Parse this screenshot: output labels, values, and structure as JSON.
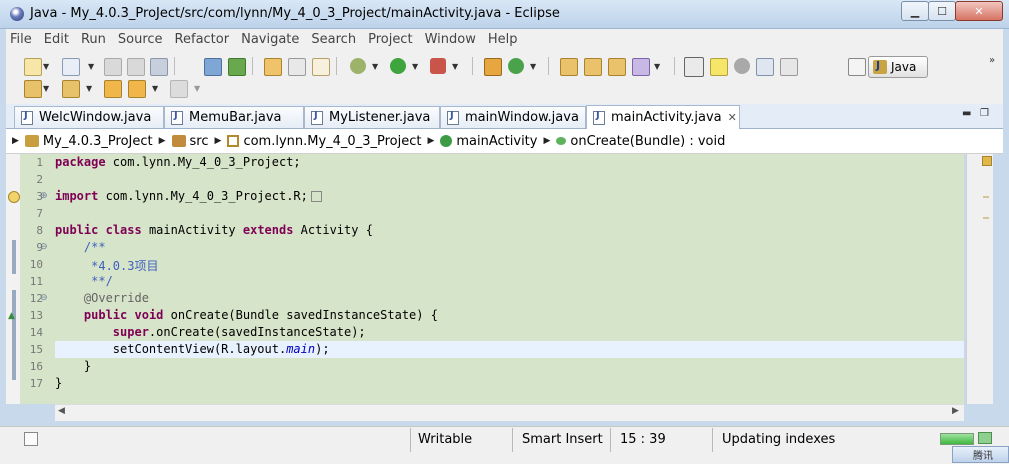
{
  "window": {
    "title": "Java - My_4.0.3_ProJect/src/com/lynn/My_4_0_3_Project/mainActivity.java - Eclipse",
    "minimize_glyph": "▁",
    "maximize_glyph": "☐",
    "close_glyph": "✕"
  },
  "menu": [
    "File",
    "Edit",
    "Run",
    "Source",
    "Refactor",
    "Navigate",
    "Search",
    "Project",
    "Window",
    "Help"
  ],
  "perspective": {
    "label": "Java"
  },
  "tabs": [
    {
      "label": "WelcWindow.java"
    },
    {
      "label": "MemuBar.java"
    },
    {
      "label": "MyListener.java"
    },
    {
      "label": "mainWindow.java"
    },
    {
      "label": "mainActivity.java",
      "active": true
    }
  ],
  "breadcrumb": [
    "My_4.0.3_ProJect",
    "src",
    "com.lynn.My_4_0_3_Project",
    "mainActivity",
    "onCreate(Bundle) : void"
  ],
  "code": {
    "line_numbers": [
      "1",
      "2",
      "3",
      "7",
      "8",
      "9",
      "10",
      "11",
      "12",
      "13",
      "14",
      "15",
      "16",
      "17"
    ],
    "lines": {
      "l1_kw": "package",
      "l1_rest": " com.lynn.My_4_0_3_Project;",
      "l3_kw": "import",
      "l3_rest": " com.lynn.My_4_0_3_Project.R;",
      "l8_kw1": "public",
      "l8_kw2": "class",
      "l8_name": " mainActivity ",
      "l8_kw3": "extends",
      "l8_rest": " Activity {",
      "l9": "    /**",
      "l10": "     *4.0.3项目",
      "l11": "     **/",
      "l12": "    @Override",
      "l13_kw1": "public",
      "l13_kw2": "void",
      "l13_rest": " onCreate(Bundle savedInstanceState) {",
      "l14_kw": "super",
      "l14_rest": ".onCreate(savedInstanceState);",
      "l15_pre": "        setContentView(R.layout.",
      "l15_field": "main",
      "l15_post": ");",
      "l16": "    }",
      "l17": "}"
    }
  },
  "status": {
    "writable": "Writable",
    "insert_mode": "Smart Insert",
    "position": "15 : 39",
    "task": "Updating indexes",
    "tray_text": "腾讯"
  },
  "colors": {
    "editor_bg": "#d6e4c9",
    "current_line": "#e8f2fe",
    "keyword": "#7f0055",
    "comment": "#3f5fbf"
  }
}
